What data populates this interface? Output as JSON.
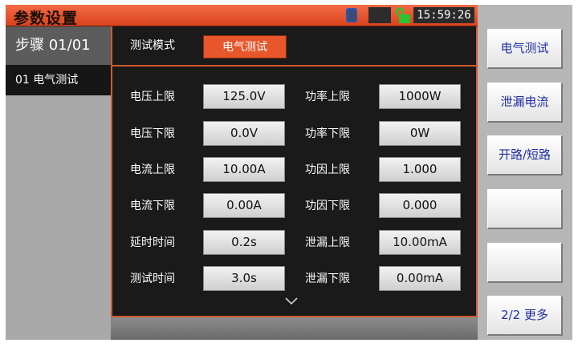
{
  "title_bar": {
    "title": "参数设置",
    "clock": "15:59:26"
  },
  "left_panel": {
    "step_header": "步骤 01/01",
    "steps": [
      {
        "label": "01 电气测试"
      }
    ]
  },
  "main": {
    "mode_label": "测试模式",
    "mode_value": "电气测试",
    "params_left": [
      {
        "label": "电压上限",
        "value": "125.0V"
      },
      {
        "label": "电压下限",
        "value": "0.0V"
      },
      {
        "label": "电流上限",
        "value": "10.00A"
      },
      {
        "label": "电流下限",
        "value": "0.00A"
      },
      {
        "label": "延时时间",
        "value": "0.2s"
      },
      {
        "label": "测试时间",
        "value": "3.0s"
      }
    ],
    "params_right": [
      {
        "label": "功率上限",
        "value": "1000W"
      },
      {
        "label": "功率下限",
        "value": "0W"
      },
      {
        "label": "功因上限",
        "value": "1.000"
      },
      {
        "label": "功因下限",
        "value": "0.000"
      },
      {
        "label": "泄漏上限",
        "value": "10.00mA"
      },
      {
        "label": "泄漏下限",
        "value": "0.00mA"
      }
    ]
  },
  "right_panel": {
    "buttons": [
      {
        "label": "电气测试"
      },
      {
        "label": "泄漏电流"
      },
      {
        "label": "开路/短路"
      },
      {
        "label": ""
      },
      {
        "label": ""
      },
      {
        "label": "2/2 更多"
      }
    ]
  },
  "colors": {
    "accent": "#e8572b",
    "title_bar": "#e4532b",
    "softkey_text": "#1f2fa0",
    "lock": "#2ec130"
  },
  "icons": {
    "usb": "usb-icon",
    "signal": "signal-icon",
    "lock": "unlock-icon",
    "scroll": "chevron-down-icon"
  }
}
